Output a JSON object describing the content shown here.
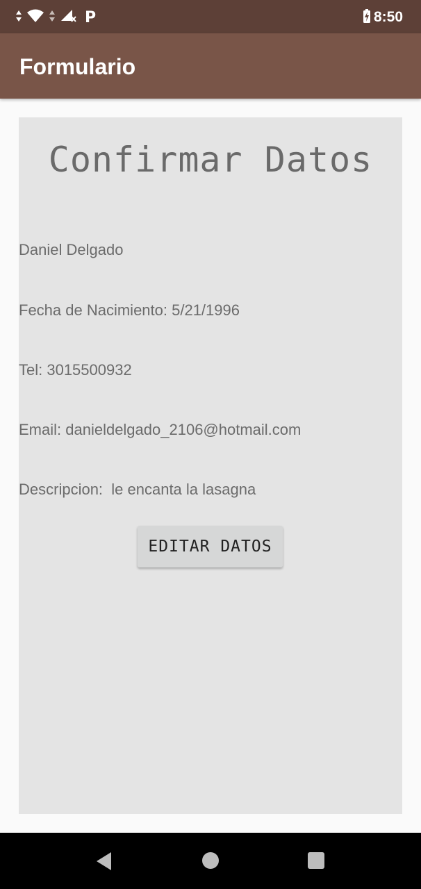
{
  "status_bar": {
    "time": "8:50",
    "left_glyph": "P",
    "icons": [
      "data-arrows-icon",
      "wifi-icon",
      "signal-icon",
      "battery-charging-icon"
    ]
  },
  "app_bar": {
    "title": "Formulario"
  },
  "content": {
    "heading": "Confirmar Datos",
    "name": "Daniel Delgado",
    "birth_date": "Fecha de Nacimiento: 5/21/1996",
    "phone": "Tel: 3015500932",
    "email": "Email: danieldelgado_2106@hotmail.com",
    "description": "Descripcion:  le encanta la lasagna",
    "edit_button_label": "EDITAR DATOS"
  },
  "nav_bar": {
    "icons": [
      "back-icon",
      "home-icon",
      "recents-icon"
    ]
  },
  "colors": {
    "status_bar": "#5d4037",
    "app_bar": "#795548",
    "panel": "#e4e4e4",
    "button": "#d6d7d7"
  }
}
